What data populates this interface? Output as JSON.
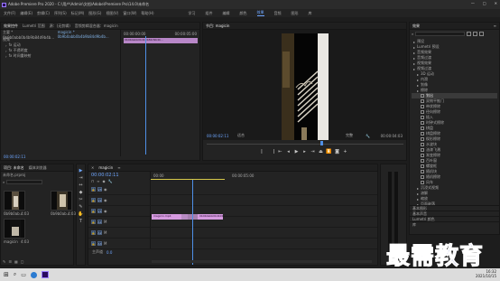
{
  "window": {
    "title": "Adobe Premiere Pro 2020 - C:\\用户\\Admin\\文档\\Adobe\\Premiere Pro\\14.0\\未命名",
    "controls": [
      "—",
      "□",
      "✕"
    ]
  },
  "menu": [
    "文件(F)",
    "编辑(E)",
    "剪辑(C)",
    "序列(S)",
    "标记(M)",
    "图形(G)",
    "视图(V)",
    "窗口(W)",
    "帮助(H)"
  ],
  "workspaces": [
    "学习",
    "组件",
    "编辑",
    "颜色",
    "效果",
    "音频",
    "图形",
    "库"
  ],
  "workspace_active": "效果",
  "source_panel": {
    "tabs": [
      "效果控件",
      "Lumetri 范围",
      "源：(无剪辑)",
      "音频剪辑混合器：magicin"
    ],
    "header": "主要 * 0b9b0abb0b4b9b84d9b4b...",
    "clip_header": "magicin * 0b9b0abb0b4b9b84d9b4b...",
    "sections": [
      "视频",
      "fx 运动",
      "fx 不透明度",
      "fx 时间重映射"
    ],
    "timecode_start": "00:00:00:00",
    "timecode_end": "00:00:05:00",
    "clip_label": "0b9b0abb0b4b9b84d9b4b...",
    "bottom_timecode": "00:00:02:11"
  },
  "program_monitor": {
    "tab": "节目: magicin",
    "timecode": "00:00:02:11",
    "fit": "适合",
    "quality": "完整",
    "duration": "00:00:04:03"
  },
  "project_panel": {
    "tabs": [
      "项目: 未命名",
      "媒体浏览器"
    ],
    "path": "未命名.prproj",
    "items": [
      {
        "name": "0b9b0ab...",
        "dur": "4:03"
      },
      {
        "name": "0b9b0ab...",
        "dur": "4:03"
      },
      {
        "name": "magicin",
        "dur": "4:03"
      }
    ]
  },
  "tools": [
    "▶",
    "⇥",
    "↔",
    "◆",
    "✂",
    "✎",
    "✋",
    "T"
  ],
  "timeline": {
    "tab": "magicin",
    "timecode": "00:00:02:11",
    "ruler": [
      "00:00",
      "00:00:05:00"
    ],
    "tracks_video": [
      "V3",
      "V2",
      "V1"
    ],
    "tracks_audio": [
      "A1",
      "A2",
      "A3"
    ],
    "master": "主声道",
    "master_value": "0.0",
    "clip_a": "magicin.mp4",
    "clip_b": "0b9b0abb0b4b9b84d9b4b"
  },
  "effects_panel": {
    "tab": "效果",
    "tree": [
      {
        "label": "预设",
        "level": 0
      },
      {
        "label": "Lumetri 预设",
        "level": 0
      },
      {
        "label": "音频效果",
        "level": 0
      },
      {
        "label": "音频过渡",
        "level": 0
      },
      {
        "label": "视频效果",
        "level": 0
      },
      {
        "label": "视频过渡",
        "level": 0
      },
      {
        "label": "3D 运动",
        "level": 1
      },
      {
        "label": "内滑",
        "level": 1
      },
      {
        "label": "划像",
        "level": 1
      },
      {
        "label": "擦除",
        "level": 1
      },
      {
        "label": "划出",
        "level": 2,
        "selected": true
      },
      {
        "label": "双侧平推门",
        "level": 2
      },
      {
        "label": "带状擦除",
        "level": 2
      },
      {
        "label": "径向擦除",
        "level": 2
      },
      {
        "label": "插入",
        "level": 2
      },
      {
        "label": "时钟式擦除",
        "level": 2
      },
      {
        "label": "棋盘",
        "level": 2
      },
      {
        "label": "棋盘擦除",
        "level": 2
      },
      {
        "label": "楔形擦除",
        "level": 2
      },
      {
        "label": "水波块",
        "level": 2
      },
      {
        "label": "油漆飞溅",
        "level": 2
      },
      {
        "label": "渐变擦除",
        "level": 2
      },
      {
        "label": "百叶窗",
        "level": 2
      },
      {
        "label": "螺旋框",
        "level": 2
      },
      {
        "label": "随机块",
        "level": 2
      },
      {
        "label": "随机擦除",
        "level": 2
      },
      {
        "label": "风车",
        "level": 2
      },
      {
        "label": "沉浸式视频",
        "level": 1
      },
      {
        "label": "溶解",
        "level": 1
      },
      {
        "label": "缩放",
        "level": 1
      },
      {
        "label": "页面剥落",
        "level": 1
      }
    ],
    "bottom": [
      "基本图形",
      "基本声音",
      "Lumetri 颜色",
      "库"
    ]
  },
  "taskbar": {
    "time": "16:32",
    "date": "2021/10/15"
  },
  "watermark": "最需教育"
}
